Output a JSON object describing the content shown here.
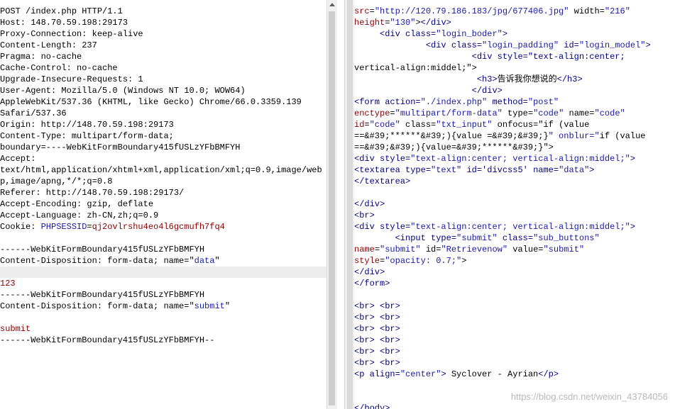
{
  "request": {
    "lines": [
      "POST /index.php HTTP/1.1",
      "Host: 148.70.59.198:29173",
      "Proxy-Connection: keep-alive",
      "Content-Length: 237",
      "Pragma: no-cache",
      "Cache-Control: no-cache",
      "Upgrade-Insecure-Requests: 1",
      "User-Agent: Mozilla/5.0 (Windows NT 10.0; WOW64)",
      "AppleWebKit/537.36 (KHTML, like Gecko) Chrome/66.0.3359.139",
      "Safari/537.36",
      "Origin: http://148.70.59.198:29173",
      "Content-Type: multipart/form-data;",
      "boundary=----WebKitFormBoundary415fUSLzYFbBMFYH",
      "Accept:",
      "text/html,application/xhtml+xml,application/xml;q=0.9,image/web",
      "p,image/apng,*/*;q=0.8",
      "Referer: http://148.70.59.198:29173/",
      "Accept-Encoding: gzip, deflate",
      "Accept-Language: zh-CN,zh;q=0.9",
      "Cookie: PHPSESSID=qj2ovlrshu4eo4l6gcmufh7fq4",
      "",
      "------WebKitFormBoundary415fUSLzYFbBMFYH",
      "Content-Disposition: form-data; name=\"data\"",
      "",
      "123",
      "------WebKitFormBoundary415fUSLzYFbBMFYH",
      "Content-Disposition: form-data; name=\"submit\"",
      "",
      "submit",
      "------WebKitFormBoundary415fUSLzYFbBMFYH--"
    ],
    "highlighted_line": 23
  },
  "response": {
    "lines": [
      "src=\"http://120.79.186.183/jpg/677406.jpg\" width=\"216\"",
      "height=\"130\"></div>",
      "     <div class=\"login_boder\">",
      "              <div class=\"login_padding\" id=\"login_model\">",
      "                       <div style=\"text-align:center;",
      "vertical-align:middel;\">",
      "                        <h3>告诉我你想说的</h3>",
      "                       </div>",
      "<form action=\"./index.php\" method=\"post\"",
      "enctype=\"multipart/form-data\" type=\"code\" name=\"code\"",
      "id=\"code\" class=\"txt_input\" onfocus=\"if (value",
      "==&#39;******&#39;){value =&#39;&#39;}\" onblur=\"if (value",
      "==&#39;&#39;){value=&#39;******&#39;}\">",
      "<div style=\"text-align:center; vertical-align:middel;\">",
      "<textarea type=\"text\" id='divcss5' name=\"data\">",
      "</textarea>",
      "",
      "</div>",
      "<br>",
      "<div style=\"text-align:center; vertical-align:middel;\">",
      "        <input type=\"submit\" class=\"sub_buttons\"",
      "name=\"submit\" id=\"Retrievenow\" value=\"submit\"",
      "style=\"opacity: 0.7;\">",
      "</div>",
      "</form>",
      "",
      "<br> <br>",
      "<br> <br>",
      "<br> <br>",
      "<br> <br>",
      "<br> <br>",
      "<br> <br>",
      "<p align=\"center\"> Syclover - Ayrian</p>",
      "",
      "",
      "</body>"
    ]
  },
  "watermark": "https://blog.csdn.net/weixin_43784056"
}
